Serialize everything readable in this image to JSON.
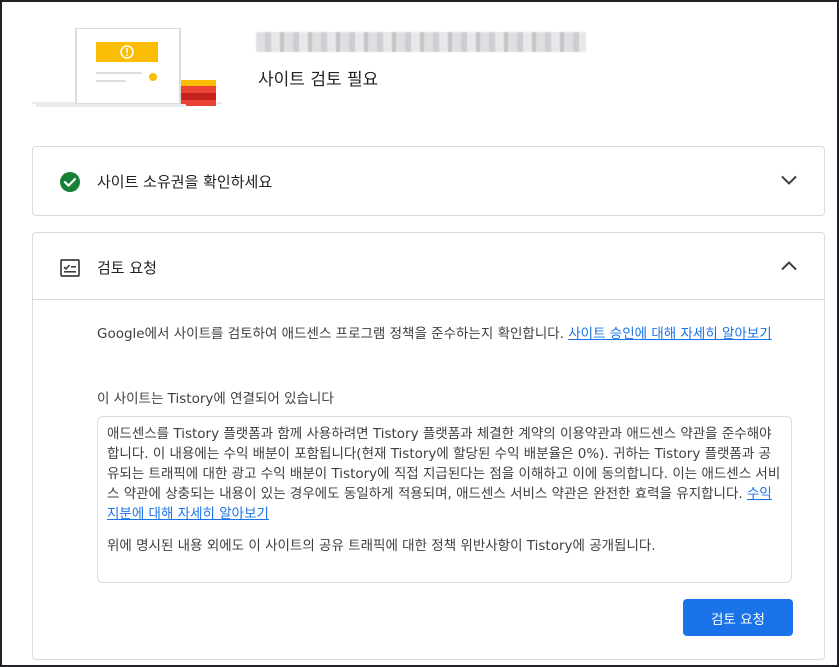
{
  "header": {
    "status_title": "사이트 검토 필요"
  },
  "sections": {
    "ownership": {
      "title": "사이트 소유권을 확인하세요",
      "state": "collapsed",
      "status_color": "#188038"
    },
    "review": {
      "title": "검토 요청",
      "state": "expanded",
      "intro_text": "Google에서 사이트를 검토하여 애드센스 프로그램 정책을 준수하는지 확인합니다. ",
      "intro_link": "사이트 승인에 대해 자세히 알아보기",
      "connected_text": "이 사이트는 Tistory에 연결되어 있습니다",
      "terms_text": "애드센스를 Tistory 플랫폼과 함께 사용하려면 Tistory 플랫폼과 체결한 계약의 이용약관과 애드센스 약관을 준수해야 합니다. 이 내용에는 수익 배분이 포함됩니다(현재 Tistory에 할당된 수익 배분율은 0%). 귀하는 Tistory 플랫폼과 공유되는 트래픽에 대한 광고 수익 배분이 Tistory에 직접 지급된다는 점을 이해하고 이에 동의합니다. 이는 애드센스 서비스 약관에 상충되는 내용이 있는 경우에도 동일하게 적용되며, 애드센스 서비스 약관은 완전한 효력을 유지합니다. ",
      "terms_link": "수익 지분에 대해 자세히 알아보기",
      "disclosure_text": "위에 명시된 내용 외에도 이 사이트의 공유 트래픽에 대한 정책 위반사항이 Tistory에 공개됩니다.",
      "button_label": "검토 요청"
    }
  },
  "colors": {
    "accent": "#1a73e8",
    "success": "#188038",
    "warning": "#fbbc04",
    "border": "#dadce0"
  },
  "icons": {
    "ownership": "check-circle-icon",
    "review": "checklist-icon",
    "collapse": "chevron-down-icon",
    "expand": "chevron-up-icon"
  }
}
